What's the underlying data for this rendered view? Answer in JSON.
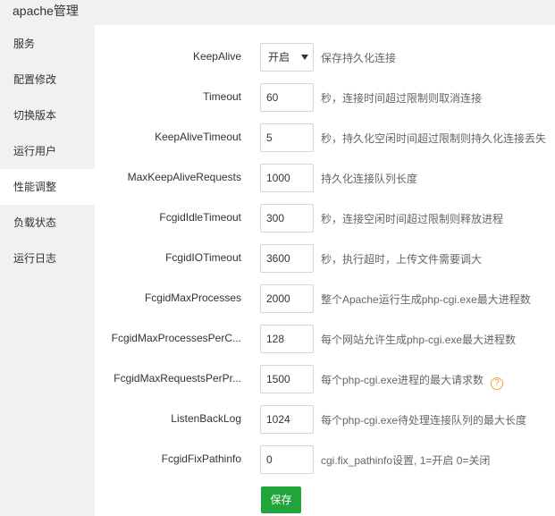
{
  "window": {
    "title": "apache管理"
  },
  "sidebar": {
    "items": [
      {
        "label": "服务"
      },
      {
        "label": "配置修改"
      },
      {
        "label": "切换版本"
      },
      {
        "label": "运行用户"
      },
      {
        "label": "性能调整",
        "active": true
      },
      {
        "label": "负载状态"
      },
      {
        "label": "运行日志"
      }
    ]
  },
  "form": {
    "rows": [
      {
        "label": "KeepAlive",
        "value": "开启",
        "control": "select",
        "desc": "保存持久化连接"
      },
      {
        "label": "Timeout",
        "value": "60",
        "desc": "秒，连接时间超过限制则取消连接"
      },
      {
        "label": "KeepAliveTimeout",
        "value": "5",
        "desc": "秒，持久化空闲时间超过限制则持久化连接丢失"
      },
      {
        "label": "MaxKeepAliveRequests",
        "value": "1000",
        "desc": "持久化连接队列长度"
      },
      {
        "label": "FcgidIdleTimeout",
        "value": "300",
        "desc": "秒，连接空闲时间超过限制则释放进程"
      },
      {
        "label": "FcgidIOTimeout",
        "value": "3600",
        "desc": "秒，执行超时，上传文件需要调大"
      },
      {
        "label": "FcgidMaxProcesses",
        "value": "2000",
        "desc": "整个Apache运行生成php-cgi.exe最大进程数"
      },
      {
        "label": "FcgidMaxProcessesPerC...",
        "value": "128",
        "desc": "每个网站允许生成php-cgi.exe最大进程数"
      },
      {
        "label": "FcgidMaxRequestsPerPr...",
        "value": "1500",
        "desc": "每个php-cgi.exe进程的最大请求数",
        "help": "?"
      },
      {
        "label": "ListenBackLog",
        "value": "1024",
        "desc": "每个php-cgi.exe待处理连接队列的最大长度"
      },
      {
        "label": "FcgidFixPathinfo",
        "value": "0",
        "desc": "cgi.fix_pathinfo设置, 1=开启 0=关闭"
      }
    ],
    "save_label": "保存"
  },
  "colors": {
    "sidebar_bg": "#f1f1f1",
    "save_button": "#20a53a",
    "help_icon": "#f39b2a"
  }
}
